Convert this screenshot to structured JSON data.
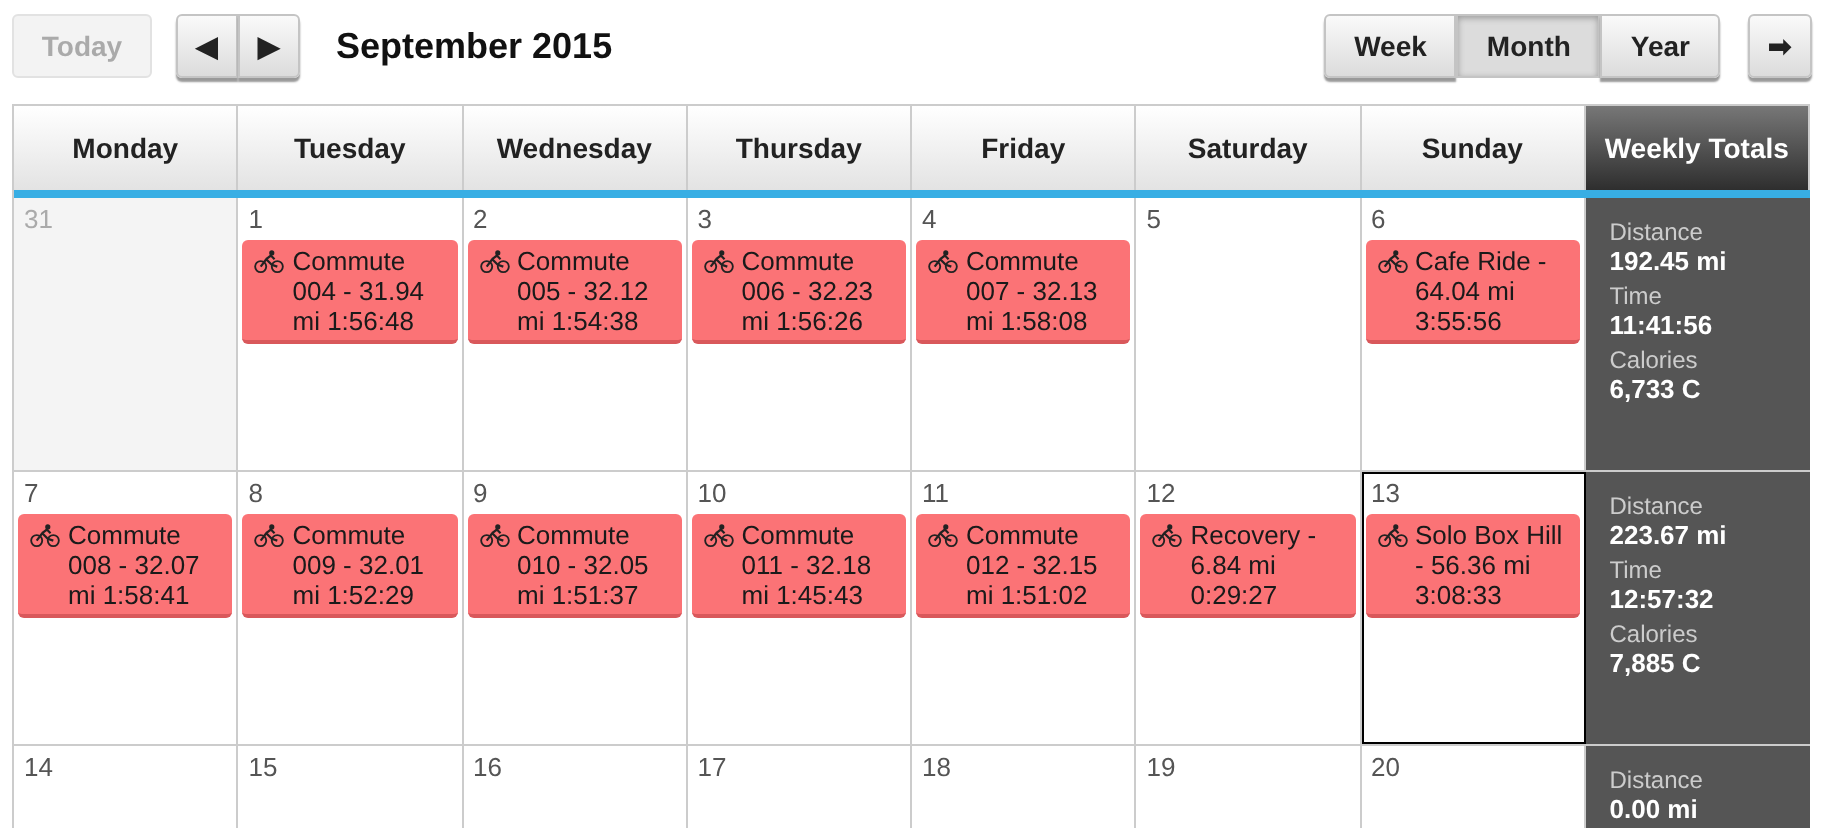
{
  "toolbar": {
    "today": {
      "label": "Today",
      "disabled": true
    },
    "prev": "◀",
    "next": "▶",
    "title": "September 2015",
    "views": [
      {
        "label": "Week",
        "selected": false
      },
      {
        "label": "Month",
        "selected": true
      },
      {
        "label": "Year",
        "selected": false
      }
    ],
    "export": "➡"
  },
  "columns": [
    "Monday",
    "Tuesday",
    "Wednesday",
    "Thursday",
    "Friday",
    "Saturday",
    "Sunday",
    "Weekly Totals"
  ],
  "weeks": [
    {
      "days": [
        {
          "date": "31",
          "out_of_month": true,
          "today": false
        },
        {
          "date": "1",
          "out_of_month": false,
          "today": false,
          "events": [
            "Commute 004 - 31.94 mi 1:56:48"
          ]
        },
        {
          "date": "2",
          "out_of_month": false,
          "today": false,
          "events": [
            "Commute 005 - 32.12 mi 1:54:38"
          ]
        },
        {
          "date": "3",
          "out_of_month": false,
          "today": false,
          "events": [
            "Commute 006 - 32.23 mi 1:56:26"
          ]
        },
        {
          "date": "4",
          "out_of_month": false,
          "today": false,
          "events": [
            "Commute 007 - 32.13 mi 1:58:08"
          ]
        },
        {
          "date": "5",
          "out_of_month": false,
          "today": false
        },
        {
          "date": "6",
          "out_of_month": false,
          "today": false,
          "events": [
            "Cafe Ride - 64.04 mi 3:55:56"
          ]
        }
      ],
      "totals": [
        {
          "label": "Distance",
          "value": "192.45 mi"
        },
        {
          "label": "Time",
          "value": "11:41:56"
        },
        {
          "label": "Calories",
          "value": "6,733 C"
        }
      ]
    },
    {
      "days": [
        {
          "date": "7",
          "out_of_month": false,
          "today": false,
          "events": [
            "Commute 008 - 32.07 mi 1:58:41"
          ]
        },
        {
          "date": "8",
          "out_of_month": false,
          "today": false,
          "events": [
            "Commute 009 - 32.01 mi 1:52:29"
          ]
        },
        {
          "date": "9",
          "out_of_month": false,
          "today": false,
          "events": [
            "Commute 010 - 32.05 mi 1:51:37"
          ]
        },
        {
          "date": "10",
          "out_of_month": false,
          "today": false,
          "events": [
            "Commute 011 - 32.18 mi 1:45:43"
          ]
        },
        {
          "date": "11",
          "out_of_month": false,
          "today": false,
          "events": [
            "Commute 012 - 32.15 mi 1:51:02"
          ]
        },
        {
          "date": "12",
          "out_of_month": false,
          "today": false,
          "events": [
            "Recovery - 6.84 mi 0:29:27"
          ]
        },
        {
          "date": "13",
          "out_of_month": false,
          "today": true,
          "events": [
            "Solo Box Hill - 56.36 mi 3:08:33"
          ]
        }
      ],
      "totals": [
        {
          "label": "Distance",
          "value": "223.67 mi"
        },
        {
          "label": "Time",
          "value": "12:57:32"
        },
        {
          "label": "Calories",
          "value": "7,885 C"
        }
      ]
    },
    {
      "days": [
        {
          "date": "14",
          "out_of_month": false,
          "today": false
        },
        {
          "date": "15",
          "out_of_month": false,
          "today": false
        },
        {
          "date": "16",
          "out_of_month": false,
          "today": false
        },
        {
          "date": "17",
          "out_of_month": false,
          "today": false
        },
        {
          "date": "18",
          "out_of_month": false,
          "today": false
        },
        {
          "date": "19",
          "out_of_month": false,
          "today": false
        },
        {
          "date": "20",
          "out_of_month": false,
          "today": false
        }
      ],
      "totals": [
        {
          "label": "Distance",
          "value": "0.00 mi"
        }
      ]
    }
  ]
}
